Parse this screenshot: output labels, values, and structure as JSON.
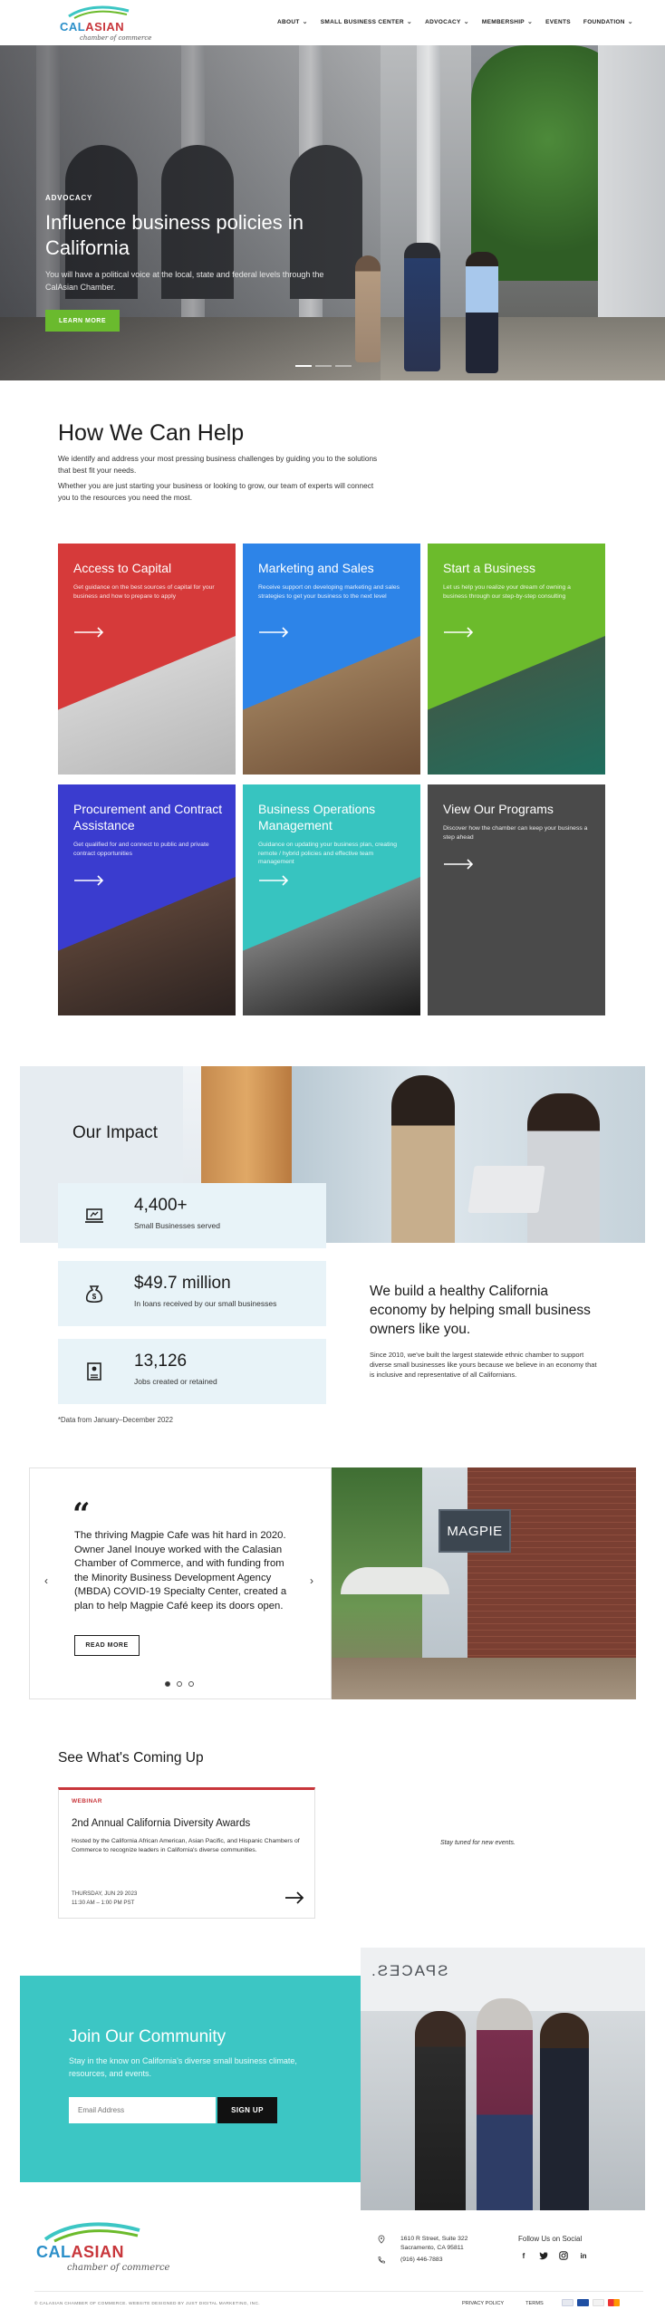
{
  "header": {
    "logo": {
      "cal": "CAL",
      "asian": "ASIAN",
      "tagline": "chamber of commerce"
    },
    "nav": [
      "ABOUT",
      "SMALL BUSINESS CENTER",
      "ADVOCACY",
      "MEMBERSHIP",
      "EVENTS",
      "FOUNDATION"
    ]
  },
  "hero": {
    "eyebrow": "ADVOCACY",
    "title": "Influence business policies in California",
    "subtitle": "You will have a political voice at the local, state and federal levels through the CalAsian Chamber.",
    "button": "LEARN MORE",
    "slides": 3,
    "active_slide": 1
  },
  "help": {
    "title": "How We Can Help",
    "p1": "We identify and address your most pressing business challenges by guiding you to the solutions that best fit your needs.",
    "p2": "Whether you are just starting your business or looking to grow, our team of experts will connect you to the resources you need the most.",
    "cards": [
      {
        "title": "Access to Capital",
        "desc": "Get guidance on the best sources of capital for your business and how to prepare to apply",
        "color": "#d63a3a"
      },
      {
        "title": "Marketing and Sales",
        "desc": "Receive support on developing marketing and sales strategies to get your business to the next level",
        "color": "#2d84e8"
      },
      {
        "title": "Start a Business",
        "desc": "Let us help you realize your dream of owning a business through our step-by-step consulting",
        "color": "#6cbb2c"
      },
      {
        "title": "Procurement and Contract Assistance",
        "desc": "Get qualified for and connect to public and private contract opportunities",
        "color": "#3a3ccf"
      },
      {
        "title": "Business Operations Management",
        "desc": "Guidance on updating  your business plan, creating remote / hybrid policies and effective team management",
        "color": "#37c4c0"
      },
      {
        "title": "View Our Programs",
        "desc": "Discover how the chamber can keep your business a step ahead",
        "color": "#4a4a4a"
      }
    ]
  },
  "impact": {
    "title": "Our Impact",
    "stats": [
      {
        "value": "4,400+",
        "label": "Small Businesses served",
        "icon": "laptop-icon"
      },
      {
        "value": "$49.7 million",
        "label": "In loans received by our small businesses",
        "icon": "money-bag-icon"
      },
      {
        "value": "13,126",
        "label": "Jobs created or retained",
        "icon": "id-badge-icon"
      }
    ],
    "note": "*Data from January–December 2022",
    "heading": "We build a healthy California economy by helping small business owners like you.",
    "body": "Since 2010, we've built the largest statewide ethnic chamber to support diverse small businesses like yours because we believe in an economy that is inclusive and representative of all Californians."
  },
  "testimonial": {
    "quote": "The thriving Magpie Cafe was hit hard in 2020. Owner Janel Inouye worked with the Calasian Chamber of Commerce, and with funding from the Minority Business Development Agency (MBDA) COVID-19 Specialty Center, created a plan to help Magpie Café keep its doors open.",
    "button": "READ MORE",
    "sign": "MAGPIE",
    "active_dot": 0
  },
  "events": {
    "title": "See What's Coming Up",
    "card": {
      "tag": "WEBINAR",
      "title": "2nd Annual California Diversity Awards",
      "desc": "Hosted by the California African American, Asian Pacific, and Hispanic Chambers of Commerce to recognize leaders in California's diverse communities.",
      "date": "THURSDAY, JUN 29 2023",
      "time": "11:30 AM – 1:00 PM PST"
    },
    "empty": "Stay tuned for new events."
  },
  "join": {
    "title": "Join Our Community",
    "text": "Stay in the know on California's diverse small business climate, resources, and events.",
    "placeholder": "Email Address",
    "button": "SIGN UP",
    "sign_text": "SPACES."
  },
  "footer": {
    "logo": {
      "cal": "CAL",
      "asian": "ASIAN",
      "tagline": "chamber of commerce"
    },
    "address1": "1610 R Street, Suite 322",
    "address2": "Sacramento, CA  95811",
    "phone": "(916) 446-7883",
    "follow": "Follow Us on Social",
    "copyright": "© CALASIAN CHAMBER OF COMMERCE. WEBSITE DESIGNED BY JUST DIGITAL MARKETING, INC.",
    "links": [
      "PRIVACY POLICY",
      "TERMS"
    ]
  }
}
